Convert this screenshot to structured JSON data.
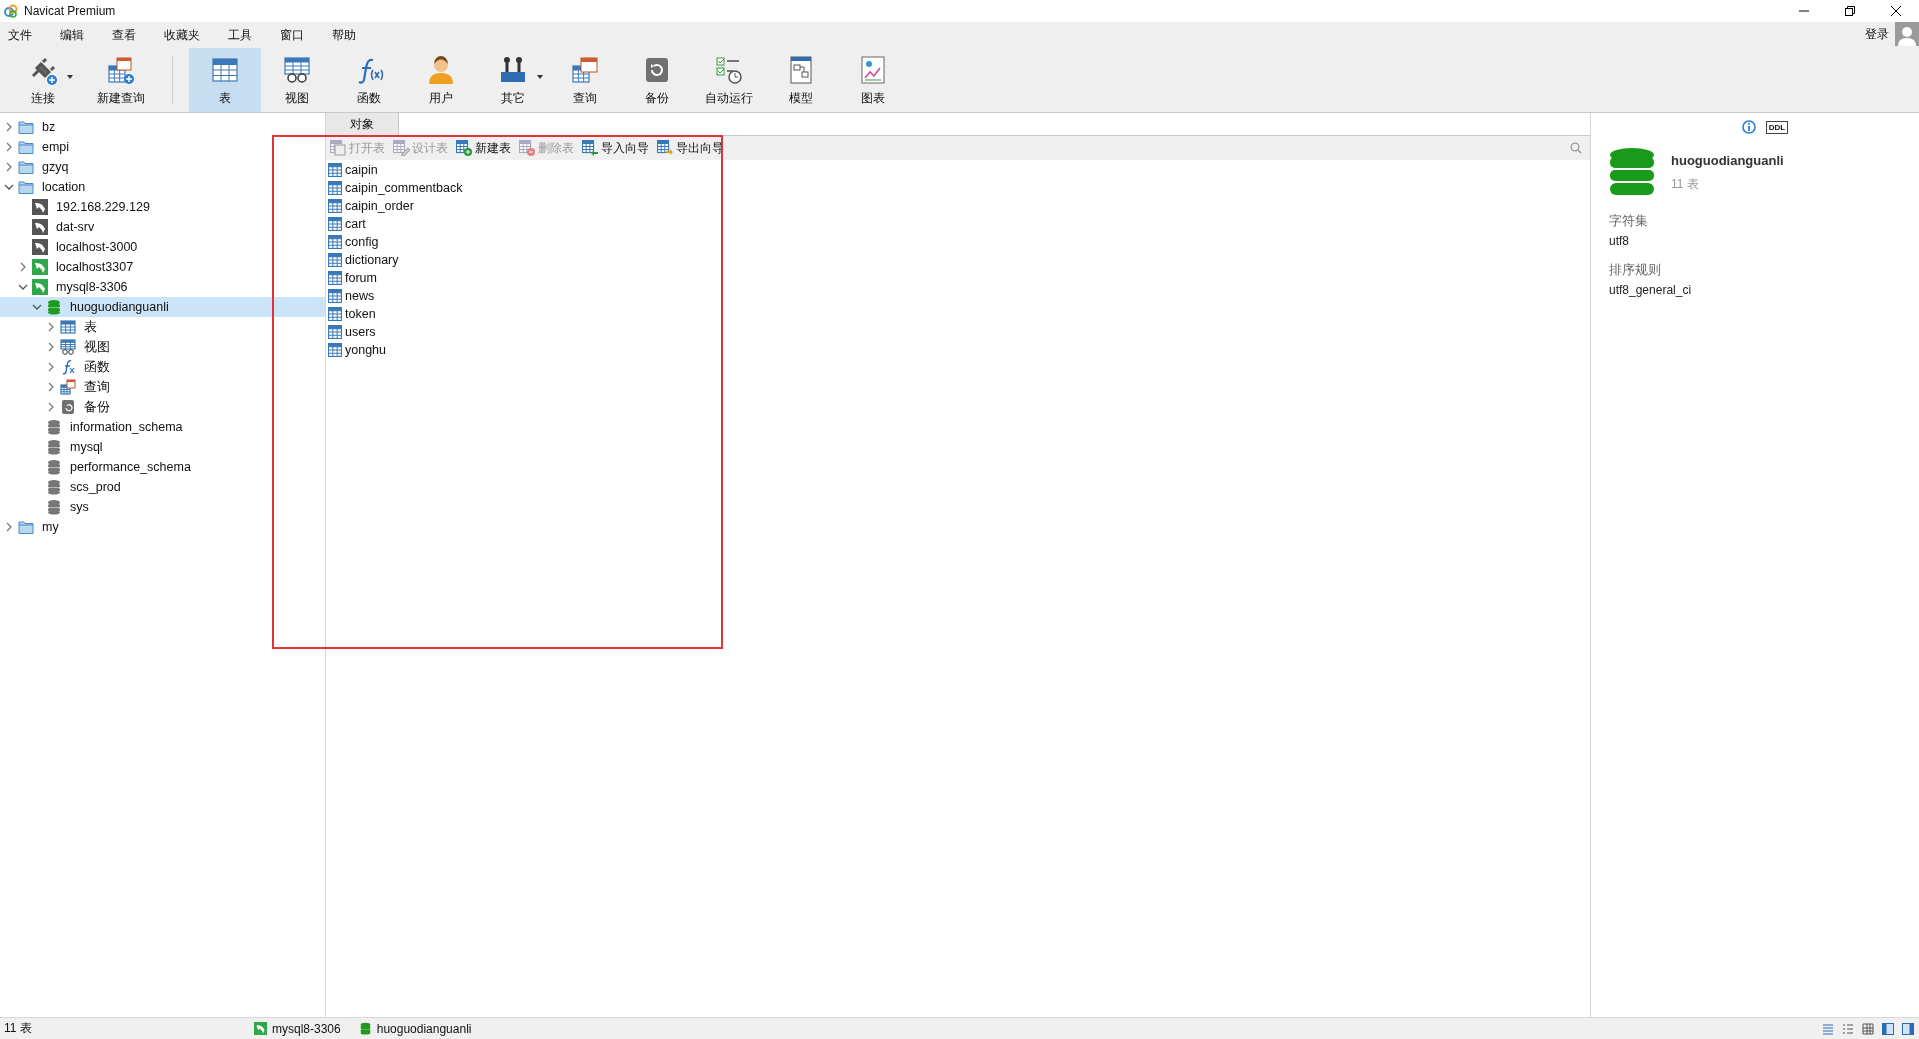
{
  "window": {
    "title": "Navicat Premium"
  },
  "menu": [
    "文件",
    "编辑",
    "查看",
    "收藏夹",
    "工具",
    "窗口",
    "帮助"
  ],
  "login": {
    "label": "登录"
  },
  "toolbar": [
    {
      "label": "连接",
      "kind": "connect",
      "selected": false,
      "dropdown": true
    },
    {
      "label": "新建查询",
      "kind": "newquery",
      "selected": false,
      "dropdown": false
    },
    {
      "label": "表",
      "kind": "table",
      "selected": true,
      "dropdown": false
    },
    {
      "label": "视图",
      "kind": "view",
      "selected": false,
      "dropdown": false
    },
    {
      "label": "函数",
      "kind": "function",
      "selected": false,
      "dropdown": false
    },
    {
      "label": "用户",
      "kind": "user",
      "selected": false,
      "dropdown": false
    },
    {
      "label": "其它",
      "kind": "other",
      "selected": false,
      "dropdown": true
    },
    {
      "label": "查询",
      "kind": "query",
      "selected": false,
      "dropdown": false
    },
    {
      "label": "备份",
      "kind": "backup",
      "selected": false,
      "dropdown": false
    },
    {
      "label": "自动运行",
      "kind": "autorun",
      "selected": false,
      "dropdown": false
    },
    {
      "label": "模型",
      "kind": "model",
      "selected": false,
      "dropdown": false
    },
    {
      "label": "图表",
      "kind": "chart",
      "selected": false,
      "dropdown": false
    }
  ],
  "sidebar": {
    "items": [
      {
        "label": "bz",
        "kind": "folder",
        "expandable": true,
        "expanded": false,
        "selected": false
      },
      {
        "label": "empi",
        "kind": "folder",
        "expandable": true,
        "expanded": false,
        "selected": false
      },
      {
        "label": "gzyq",
        "kind": "folder",
        "expandable": true,
        "expanded": false,
        "selected": false
      },
      {
        "label": "location",
        "kind": "folder",
        "expandable": true,
        "expanded": true,
        "selected": false,
        "children": [
          {
            "label": "192.168.229.129",
            "kind": "conn-off",
            "expandable": false,
            "selected": false
          },
          {
            "label": "dat-srv",
            "kind": "conn-off",
            "expandable": false,
            "selected": false
          },
          {
            "label": "localhost-3000",
            "kind": "conn-off",
            "expandable": false,
            "selected": false
          },
          {
            "label": "localhost3307",
            "kind": "conn-on",
            "expandable": true,
            "expanded": false,
            "selected": false
          },
          {
            "label": "mysql8-3306",
            "kind": "conn-on",
            "expandable": true,
            "expanded": true,
            "selected": false,
            "children": [
              {
                "label": "huoguodianguanli",
                "kind": "db-open",
                "expandable": true,
                "expanded": true,
                "selected": true,
                "children": [
                  {
                    "label": "表",
                    "kind": "tables",
                    "expandable": true,
                    "expanded": false,
                    "selected": false
                  },
                  {
                    "label": "视图",
                    "kind": "views",
                    "expandable": true,
                    "expanded": false,
                    "selected": false
                  },
                  {
                    "label": "函数",
                    "kind": "functions",
                    "expandable": true,
                    "expanded": false,
                    "selected": false
                  },
                  {
                    "label": "查询",
                    "kind": "queries",
                    "expandable": true,
                    "expanded": false,
                    "selected": false
                  },
                  {
                    "label": "备份",
                    "kind": "backups",
                    "expandable": true,
                    "expanded": false,
                    "selected": false
                  }
                ]
              },
              {
                "label": "information_schema",
                "kind": "db",
                "expandable": false,
                "selected": false
              },
              {
                "label": "mysql",
                "kind": "db",
                "expandable": false,
                "selected": false
              },
              {
                "label": "performance_schema",
                "kind": "db",
                "expandable": false,
                "selected": false
              },
              {
                "label": "scs_prod",
                "kind": "db",
                "expandable": false,
                "selected": false
              },
              {
                "label": "sys",
                "kind": "db",
                "expandable": false,
                "selected": false
              }
            ]
          }
        ]
      },
      {
        "label": "my",
        "kind": "folder",
        "expandable": true,
        "expanded": false,
        "selected": false
      }
    ]
  },
  "tabs": [
    {
      "label": "对象",
      "selected": true
    }
  ],
  "object_toolbar": [
    {
      "label": "打开表",
      "kind": "open",
      "disabled": true
    },
    {
      "label": "设计表",
      "kind": "design",
      "disabled": true
    },
    {
      "label": "新建表",
      "kind": "new",
      "disabled": false
    },
    {
      "label": "删除表",
      "kind": "delete",
      "disabled": true
    },
    {
      "label": "导入向导",
      "kind": "import",
      "disabled": false
    },
    {
      "label": "导出向导",
      "kind": "export",
      "disabled": false
    }
  ],
  "tables": [
    "caipin",
    "caipin_commentback",
    "caipin_order",
    "cart",
    "config",
    "dictionary",
    "forum",
    "news",
    "token",
    "users",
    "yonghu"
  ],
  "info_panel": {
    "tabs": [
      {
        "kind": "info",
        "selected": true
      },
      {
        "kind": "ddl",
        "label": "DDL",
        "selected": false
      }
    ],
    "name": "huoguodianguanli",
    "count": "11 表",
    "fields": [
      {
        "label": "字符集",
        "value": "utf8"
      },
      {
        "label": "排序规则",
        "value": "utf8_general_ci"
      }
    ]
  },
  "status_bar": {
    "count": "11 表",
    "connection": "mysql8-3306",
    "database": "huoguodianguanli"
  }
}
